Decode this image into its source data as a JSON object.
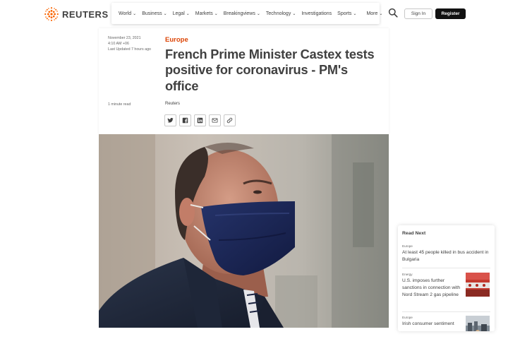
{
  "header": {
    "logo_text": "REUTERS",
    "nav_items": [
      "World",
      "Business",
      "Legal",
      "Markets",
      "Breakingviews",
      "Technology",
      "Investigations",
      "Sports",
      "More"
    ],
    "signin_label": "Sign In",
    "register_label": "Register",
    "icons": {
      "search": "search-icon",
      "chevron": "chevron-down-icon"
    }
  },
  "article": {
    "date": "November 23, 2021",
    "time": "4:10 AM +06",
    "updated": "Last Updated 7 hours ago",
    "read_time": "1 minute read",
    "category": "Europe",
    "headline": "French Prime Minister Castex tests positive for coronavirus - PM's office",
    "byline": "Reuters",
    "share_icons": [
      "twitter-icon",
      "facebook-icon",
      "linkedin-icon",
      "email-icon",
      "link-icon"
    ],
    "accent_color": "#dc4405"
  },
  "read_next": {
    "title": "Read Next",
    "items": [
      {
        "category": "Europe",
        "text": "At least 45 people killed in bus accident in Bulgaria"
      },
      {
        "category": "Energy",
        "text": "U.S. imposes further sanctions in connection with Nord Stream 2 gas pipeline"
      },
      {
        "category": "Europe",
        "text": "Irish consumer sentiment"
      }
    ]
  }
}
